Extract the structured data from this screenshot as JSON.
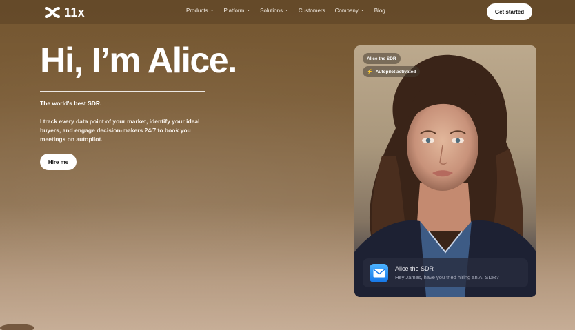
{
  "brand": {
    "name": "11x",
    "logo_icon": "infinity-x-logo"
  },
  "nav": {
    "items": [
      {
        "label": "Products",
        "has_dropdown": true
      },
      {
        "label": "Platform",
        "has_dropdown": true
      },
      {
        "label": "Solutions",
        "has_dropdown": true
      },
      {
        "label": "Customers",
        "has_dropdown": false
      },
      {
        "label": "Company",
        "has_dropdown": true
      },
      {
        "label": "Blog",
        "has_dropdown": false
      }
    ],
    "cta": "Get started"
  },
  "hero": {
    "title": "Hi, I’m Alice.",
    "tagline": "The world’s best SDR.",
    "description": "I track every data point of your market, identify your ideal buyers, and engage decision-makers 24/7 to book you meetings on autopilot.",
    "cta": "Hire me"
  },
  "card": {
    "name_pill": "Alice the SDR",
    "status_pill": "Autopilot activated",
    "notification": {
      "icon": "mail-icon",
      "title": "Alice the SDR",
      "message": "Hey James, have you tried hiring an AI SDR?"
    }
  },
  "colors": {
    "background_top": "#73552f",
    "background_bottom": "#c6ad96",
    "mail_icon": "#1e86f0"
  }
}
